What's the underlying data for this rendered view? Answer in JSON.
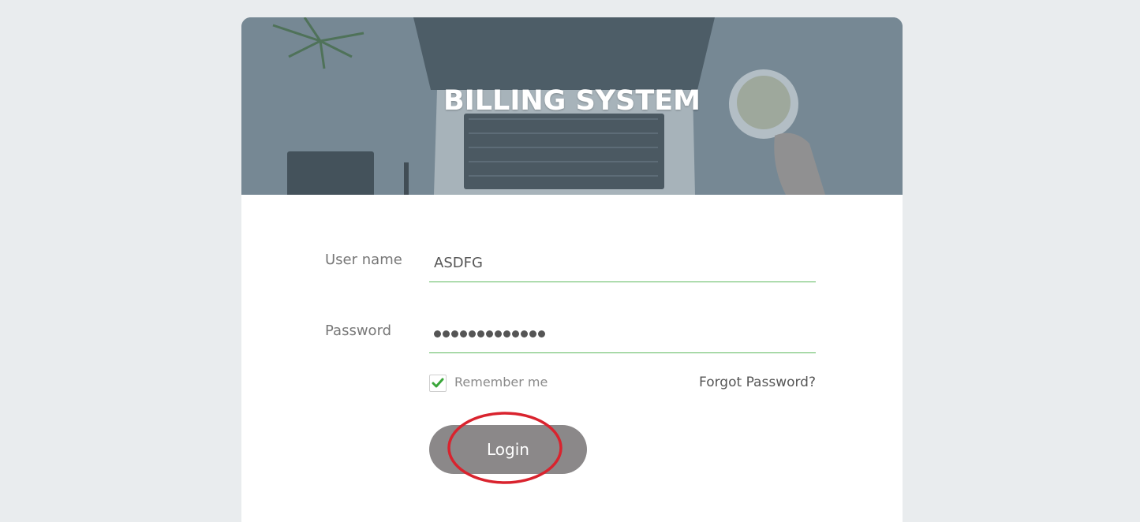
{
  "banner": {
    "title": "BILLING SYSTEM"
  },
  "form": {
    "username_label": "User name",
    "username_value": "ASDFG",
    "password_label": "Password",
    "password_masked_length": 13,
    "remember_label": "Remember me",
    "remember_checked": true,
    "forgot_label": "Forgot Password?",
    "login_label": "Login"
  },
  "colors": {
    "page_bg": "#e9ecee",
    "field_underline": "#5cb85c",
    "checkmark": "#3aa63a",
    "button_bg": "#8b8889",
    "annotation": "#d9232e"
  }
}
